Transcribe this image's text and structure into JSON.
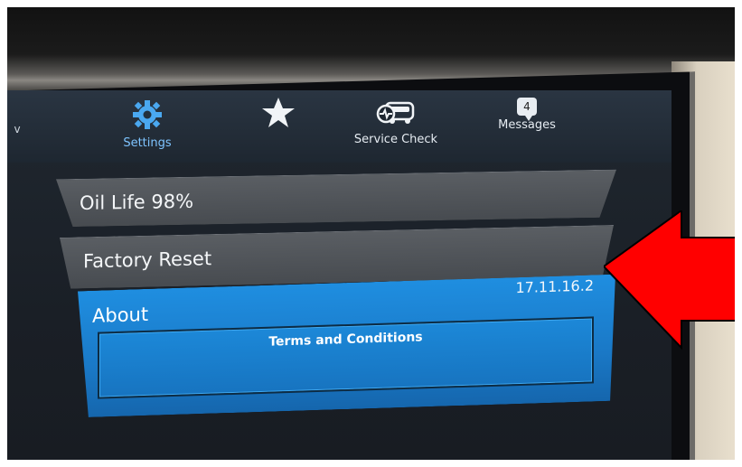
{
  "nav": {
    "left_arrow": "v",
    "settings_label": "Settings",
    "favorites_icon": "star-icon",
    "service_check_label": "Service Check",
    "messages_label": "Messages",
    "messages_count": "4"
  },
  "menu": {
    "oil_life_label": "Oil Life 98%",
    "factory_reset_label": "Factory Reset",
    "about_label": "About",
    "about_version": "17.11.16.2",
    "terms_label": "Terms and Conditions"
  },
  "colors": {
    "accent_blue": "#1a7fd0",
    "arrow_red": "#ff0000",
    "row_gray": "#4f5358"
  }
}
